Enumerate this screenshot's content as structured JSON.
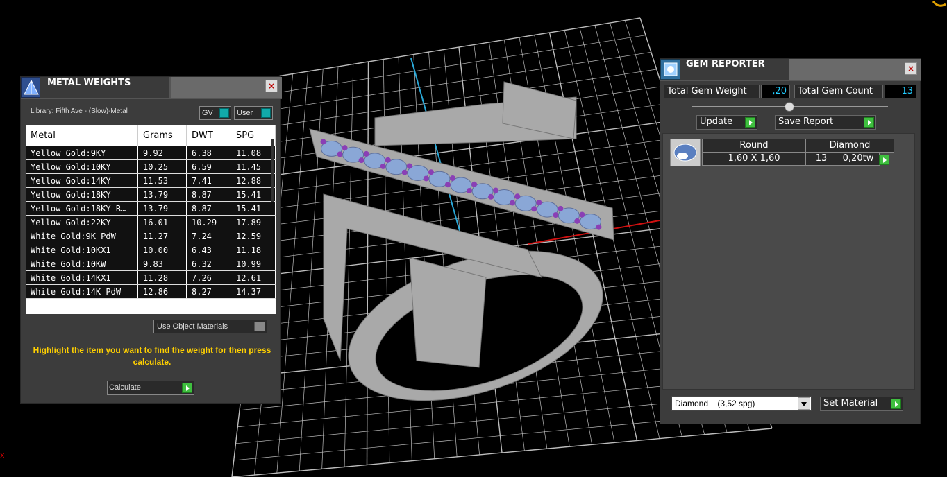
{
  "viewport": {
    "axis_x_label": "x",
    "colors": {
      "grid": "#bdbdbd",
      "model": "#a9a9a9",
      "gem": "#8aa7d6",
      "prong": "#8a3fb5",
      "axis_x": "#d01010",
      "axis_y": "#2aa8d8"
    }
  },
  "metal_weights": {
    "title": "METAL WEIGHTS",
    "close_label": "×",
    "library": "Library: Fifth Ave - (Slow)-Metal",
    "toggle_gv": "GV",
    "toggle_user": "User",
    "columns": [
      "Metal",
      "Grams",
      "DWT",
      "SPG"
    ],
    "rows": [
      [
        "Yellow Gold:9KY",
        "9.92",
        "6.38",
        "11.08"
      ],
      [
        "Yellow Gold:10KY",
        "10.25",
        "6.59",
        "11.45"
      ],
      [
        "Yellow Gold:14KY",
        "11.53",
        "7.41",
        "12.88"
      ],
      [
        "Yellow Gold:18KY",
        "13.79",
        "8.87",
        "15.41"
      ],
      [
        "Yellow Gold:18KY R…",
        "13.79",
        "8.87",
        "15.41"
      ],
      [
        "Yellow Gold:22KY",
        "16.01",
        "10.29",
        "17.89"
      ],
      [
        "White Gold:9K PdW",
        "11.27",
        "7.24",
        "12.59"
      ],
      [
        "White Gold:10KX1",
        "10.00",
        "6.43",
        "11.18"
      ],
      [
        "White Gold:10KW",
        "9.83",
        "6.32",
        "10.99"
      ],
      [
        "White Gold:14KX1",
        "11.28",
        "7.26",
        "12.61"
      ],
      [
        "White Gold:14K PdW",
        "12.86",
        "8.27",
        "14.37"
      ]
    ],
    "use_object_materials": "Use Object Materials",
    "hint": "Highlight the item you want to find the weight for then press calculate.",
    "calculate_label": "Calculate"
  },
  "gem_reporter": {
    "title": "GEM REPORTER",
    "close_label": "×",
    "total_weight_label": "Total Gem Weight",
    "total_weight_value": ",20",
    "total_count_label": "Total Gem Count",
    "total_count_value": "13",
    "update_label": "Update",
    "save_report_label": "Save Report",
    "gem": {
      "shape": "Round",
      "material": "Diamond",
      "size": "1,60 X 1,60",
      "count": "13",
      "weight": "0,20tw"
    },
    "material_select": "Diamond    (3,52 spg)",
    "set_material_label": "Set Material"
  }
}
